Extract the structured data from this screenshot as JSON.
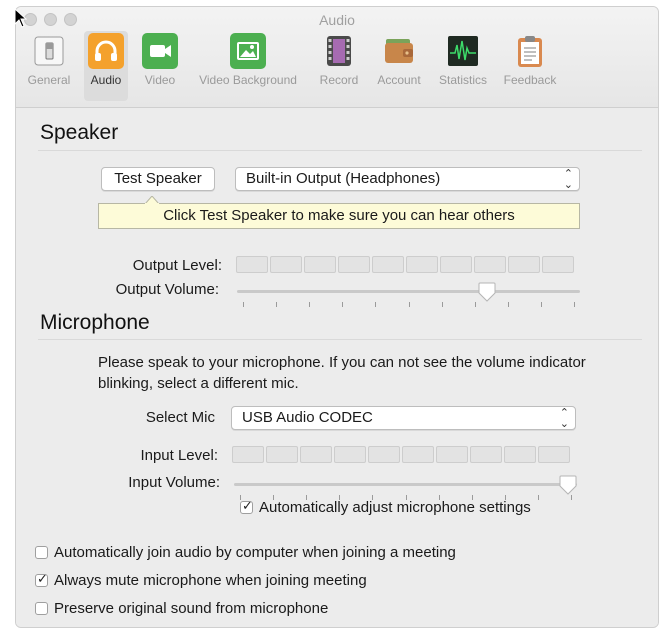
{
  "window": {
    "title": "Audio"
  },
  "toolbar": [
    {
      "label": "General",
      "icon": "switch-icon"
    },
    {
      "label": "Audio",
      "icon": "headphones-icon"
    },
    {
      "label": "Video",
      "icon": "video-camera-icon"
    },
    {
      "label": "Video Background",
      "icon": "picture-icon"
    },
    {
      "label": "Record",
      "icon": "film-icon"
    },
    {
      "label": "Account",
      "icon": "wallet-icon"
    },
    {
      "label": "Statistics",
      "icon": "waveform-icon"
    },
    {
      "label": "Feedback",
      "icon": "clipboard-icon"
    }
  ],
  "speaker": {
    "heading": "Speaker",
    "test_button": "Test Speaker",
    "output_device": "Built-in Output (Headphones)",
    "tooltip": "Click Test Speaker to make sure you can hear others",
    "output_level_label": "Output Level:",
    "output_volume_label": "Output Volume:",
    "output_volume_fraction": 0.74
  },
  "microphone": {
    "heading": "Microphone",
    "instruction": "Please speak to your microphone. If you can not see the volume indicator blinking, select a different mic.",
    "select_label": "Select Mic",
    "selected_mic": "USB Audio CODEC",
    "input_level_label": "Input Level:",
    "input_volume_label": "Input Volume:",
    "input_volume_fraction": 1.0,
    "auto_adjust_label": "Automatically adjust microphone settings",
    "auto_adjust_checked": true
  },
  "options": [
    {
      "label": "Automatically join audio by computer when joining a meeting",
      "checked": false
    },
    {
      "label": "Always mute microphone when joining meeting",
      "checked": true
    },
    {
      "label": "Preserve original sound from microphone",
      "checked": false
    }
  ],
  "check_glyph": "✓",
  "select_arrows": "⌃⌄",
  "colors": {
    "audio_accent": "#f4a12c",
    "tooltip_bg": "#fdfbd8"
  }
}
